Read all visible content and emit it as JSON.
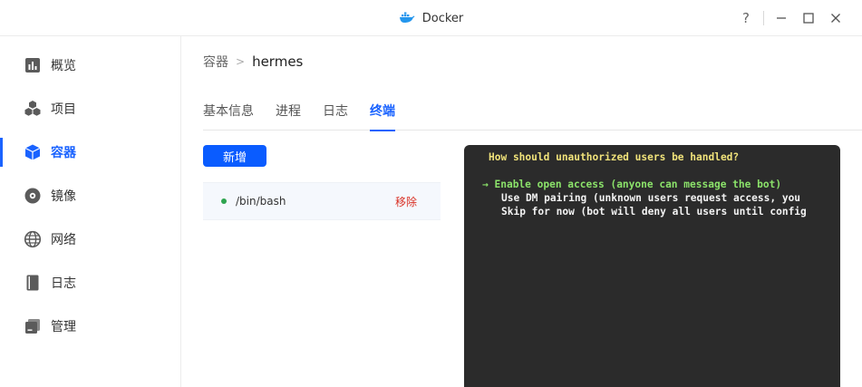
{
  "window": {
    "title": "Docker"
  },
  "window_controls": {
    "help": "?",
    "minimize": "—",
    "maximize": "☐",
    "close": "✕"
  },
  "sidebar": {
    "items": [
      {
        "label": "概览",
        "icon": "chart-icon"
      },
      {
        "label": "项目",
        "icon": "cubes-icon"
      },
      {
        "label": "容器",
        "icon": "container-icon",
        "active": true
      },
      {
        "label": "镜像",
        "icon": "disc-icon"
      },
      {
        "label": "网络",
        "icon": "globe-icon"
      },
      {
        "label": "日志",
        "icon": "book-icon"
      },
      {
        "label": "管理",
        "icon": "manage-icon"
      }
    ]
  },
  "breadcrumb": {
    "root": "容器",
    "separator": ">",
    "current": "hermes"
  },
  "tabs": [
    {
      "label": "基本信息"
    },
    {
      "label": "进程"
    },
    {
      "label": "日志"
    },
    {
      "label": "终端",
      "active": true
    }
  ],
  "add_button": "新增",
  "sessions": [
    {
      "name": "/bin/bash",
      "status": "running",
      "remove": "移除"
    }
  ],
  "terminal": {
    "question": "How should unauthorized users be handled?",
    "options": [
      {
        "prefix": "→ ",
        "text": "Enable open access (anyone can message the bot)",
        "selected": true
      },
      {
        "prefix": "",
        "text": "Use DM pairing (unknown users request access, you",
        "selected": false
      },
      {
        "prefix": "",
        "text": "Skip for now (bot will deny all users until config",
        "selected": false
      }
    ]
  },
  "colors": {
    "accent": "#1a63ff",
    "button": "#0a5cff",
    "terminal_bg": "#2b2b2b",
    "question": "#f0e27a",
    "selected": "#8be26a",
    "danger": "#d93025",
    "status_running": "#2ea44f"
  }
}
